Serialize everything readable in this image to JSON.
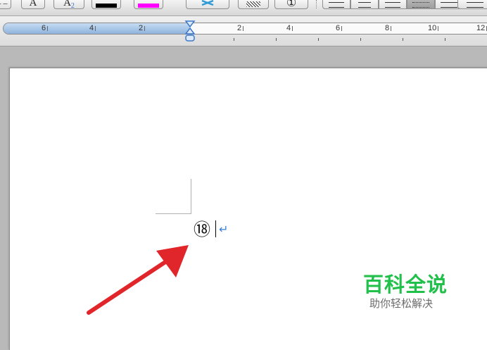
{
  "toolbar": {
    "superscript_label": "A",
    "subscript_label": "A",
    "subscript_suffix": "2",
    "font_color": "#000000",
    "highlight_color": "#ff00ff",
    "enclose_char_label": "①"
  },
  "ruler": {
    "left_labels": [
      "6",
      "4",
      "2"
    ],
    "right_labels": [
      "2",
      "4",
      "6",
      "8",
      "10",
      "12"
    ]
  },
  "document": {
    "enclosed_character": "⑱",
    "paragraph_mark": "↵"
  },
  "watermark": {
    "title": "百科全说",
    "subtitle": "助你轻松解决"
  },
  "colors": {
    "arrow": "#e0262b",
    "watermark_green": "#20c04a"
  }
}
